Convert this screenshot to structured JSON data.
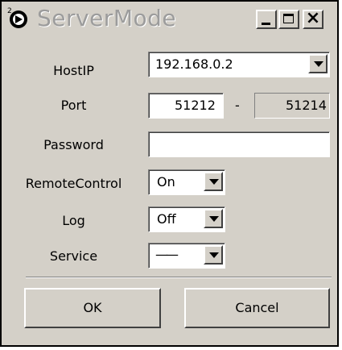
{
  "window": {
    "title": "ServerMode"
  },
  "titlebar": {
    "icon": "app-gear-icon",
    "controls": [
      "minimize-icon",
      "maximize-icon",
      "close-icon"
    ]
  },
  "form": {
    "host_ip": {
      "label": "HostIP",
      "value": "192.168.0.2"
    },
    "port": {
      "label": "Port",
      "start": "51212",
      "separator": "-",
      "end": "51214"
    },
    "password": {
      "label": "Password",
      "value": ""
    },
    "remote_control": {
      "label": "RemoteControl",
      "value": "On"
    },
    "log": {
      "label": "Log",
      "value": "Off"
    },
    "service": {
      "label": "Service",
      "value": "——"
    }
  },
  "buttons": {
    "ok": "OK",
    "cancel": "Cancel"
  },
  "colors": {
    "face": "#d4d0c8",
    "title_text": "#9c9c9c",
    "field_bg": "#ffffff"
  }
}
